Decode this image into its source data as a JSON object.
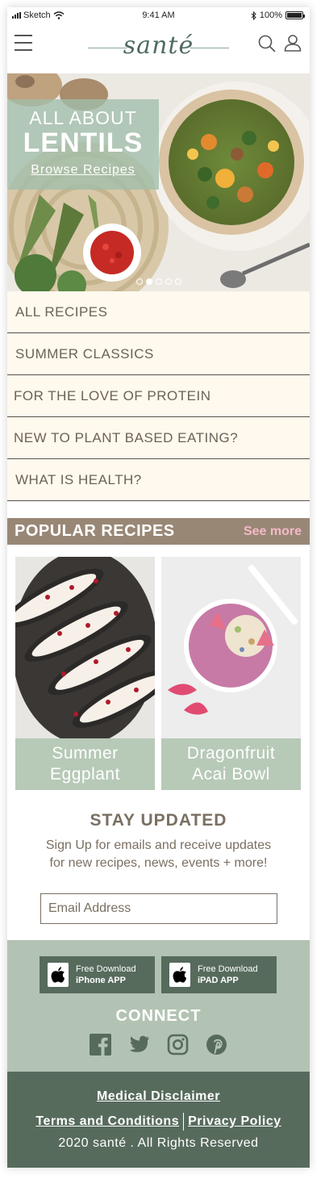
{
  "status_bar": {
    "carrier": "Sketch",
    "time": "9:41 AM",
    "battery": "100%"
  },
  "header": {
    "logo_text": "santé",
    "menu_icon": "hamburger-menu-icon",
    "search_icon": "search-icon",
    "account_icon": "user-icon"
  },
  "hero": {
    "line1": "ALL ABOUT",
    "line2": "LENTILS",
    "cta": "Browse Recipes",
    "slides": 5,
    "active_slide": 2
  },
  "categories": [
    "ALL RECIPES",
    "SUMMER CLASSICS",
    "FOR THE LOVE OF PROTEIN",
    "NEW TO PLANT BASED EATING?",
    "WHAT IS HEALTH?"
  ],
  "popular": {
    "title": "POPULAR RECIPES",
    "see_more": "See more",
    "cards": [
      {
        "line1": "Summer",
        "line2": "Eggplant"
      },
      {
        "line1": "Dragonfruit",
        "line2": "Acai Bowl"
      }
    ]
  },
  "newsletter": {
    "title": "STAY UPDATED",
    "text": "Sign Up for emails and receive updates for new recipes, news, events  + more!",
    "email_placeholder": "Email Address"
  },
  "apps": {
    "iphone": {
      "line1": "Free Download",
      "line2": "iPhone APP"
    },
    "ipad": {
      "line1": "Free Download",
      "line2": "iPAD APP"
    },
    "connect": "CONNECT",
    "socials": [
      "facebook-icon",
      "twitter-icon",
      "instagram-icon",
      "pinterest-icon"
    ]
  },
  "footer": {
    "disclaimer": "Medical Disclaimer",
    "terms": "Terms and Conditions",
    "privacy": "Privacy Policy",
    "copyright": "2020 santé . All Rights Reserved"
  },
  "colors": {
    "sage": "#b3c3b3",
    "dark_green": "#576b5d",
    "taupe": "#998776",
    "cream": "#fff9ee",
    "pink": "#f4b9c8",
    "text": "#6d6355"
  }
}
